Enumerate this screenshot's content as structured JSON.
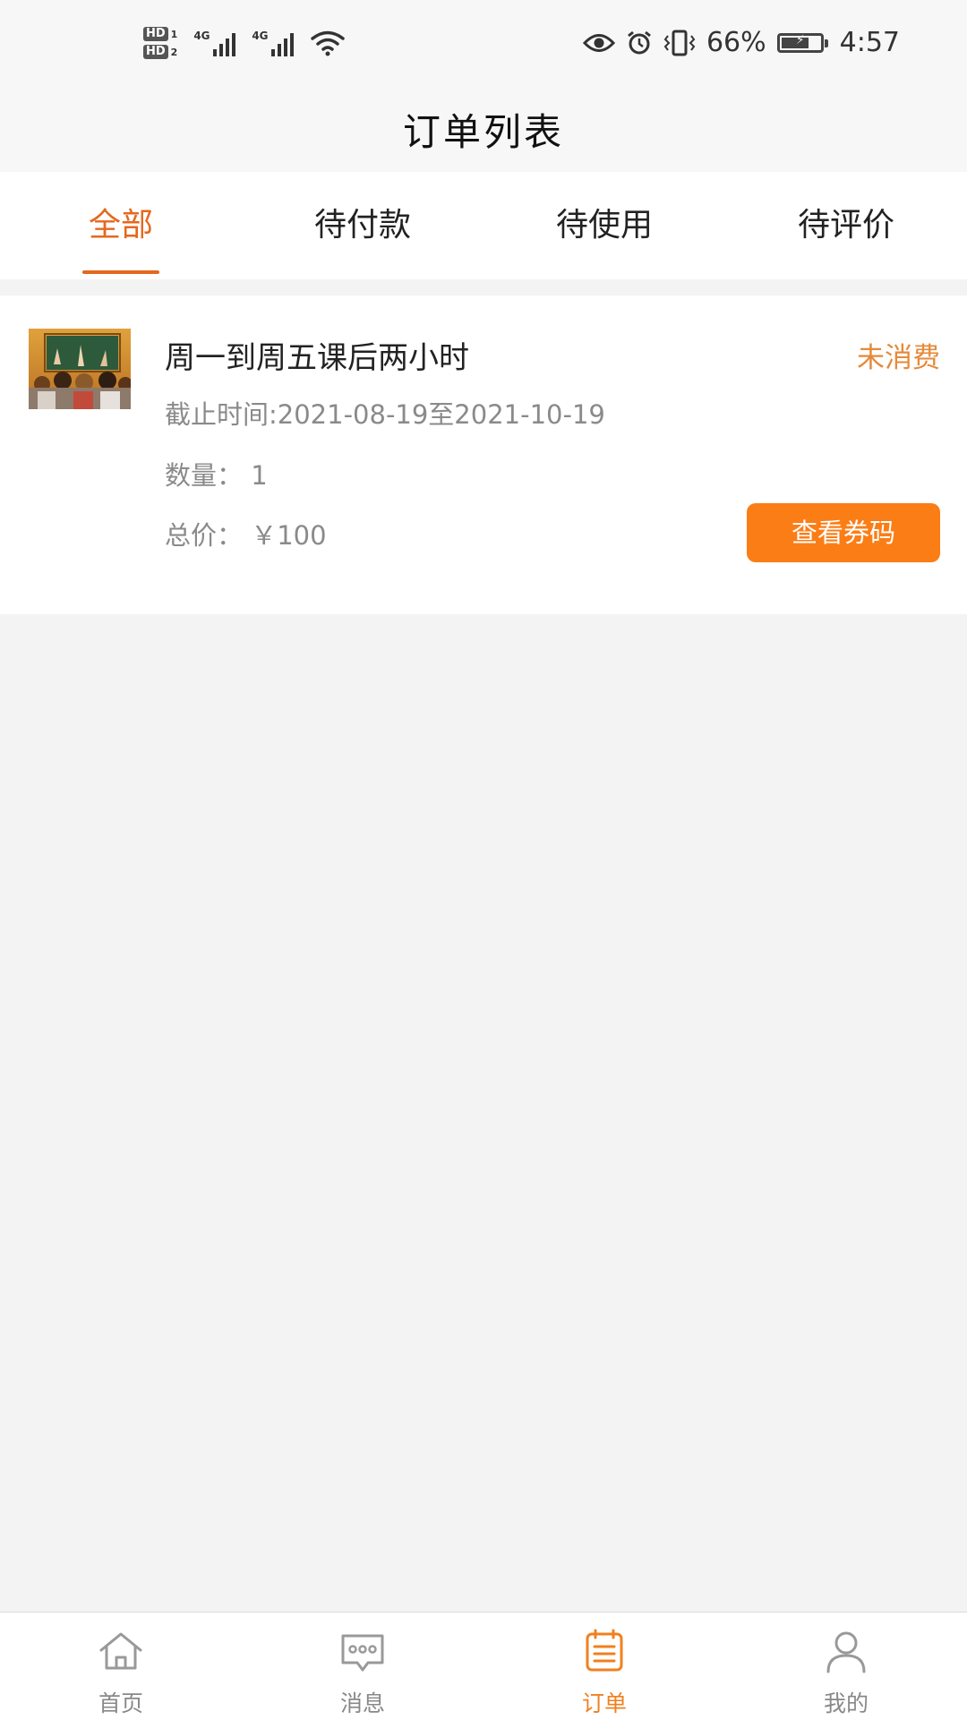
{
  "status_bar": {
    "hd1": "HD",
    "hd1_num": "1",
    "hd2": "HD",
    "hd2_num": "2",
    "net1": "4G",
    "net2": "4G",
    "battery_percent": "66%",
    "battery_level": 0.66,
    "time": "4:57",
    "icons": [
      "eye-icon",
      "alarm-icon",
      "vibrate-icon",
      "wifi-icon",
      "battery-icon"
    ]
  },
  "header": {
    "title": "订单列表"
  },
  "tabs": [
    {
      "label": "全部",
      "active": true
    },
    {
      "label": "待付款",
      "active": false
    },
    {
      "label": "待使用",
      "active": false
    },
    {
      "label": "待评价",
      "active": false
    }
  ],
  "orders": [
    {
      "title": "周一到周五课后两小时",
      "status": "未消费",
      "deadline": "截止时间:2021-08-19至2021-10-19",
      "quantity": "数量： 1",
      "total": "总价： ￥100",
      "button": "查看券码"
    }
  ],
  "bottom_nav": [
    {
      "label": "首页",
      "icon": "home-icon",
      "active": false
    },
    {
      "label": "消息",
      "icon": "message-icon",
      "active": false
    },
    {
      "label": "订单",
      "icon": "order-icon",
      "active": true
    },
    {
      "label": "我的",
      "icon": "profile-icon",
      "active": false
    }
  ],
  "colors": {
    "accent": "#e4681e",
    "button": "#fb7d16",
    "status": "#e58a3a",
    "nav_active": "#f0801f"
  }
}
